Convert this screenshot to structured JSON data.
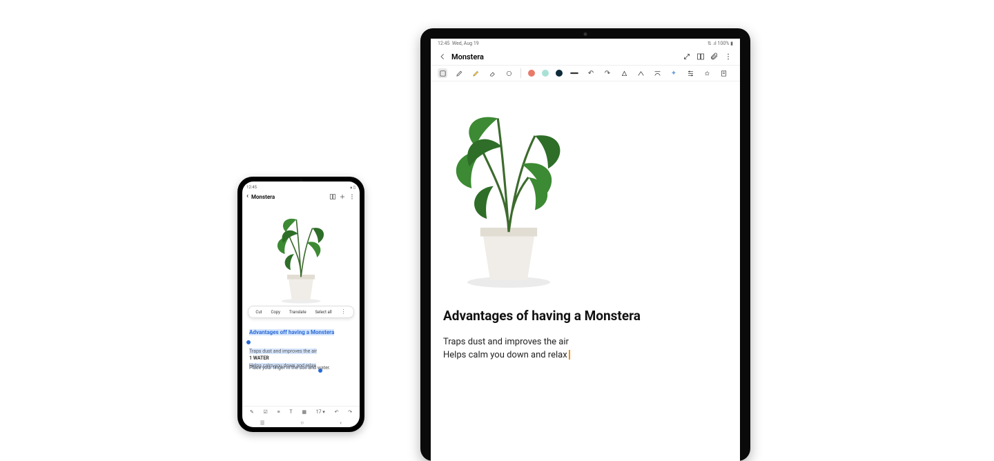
{
  "phone": {
    "status_time": "12:45",
    "title": "Monstera",
    "context_menu": {
      "cut": "Cut",
      "copy": "Copy",
      "translate": "Translate",
      "select_all": "Select all"
    },
    "heading": "Advantages off having a Monstera",
    "line1": "Traps dust and improves the air",
    "line2": "Helps calm you down and relax",
    "water_label": "1 WATER",
    "water_text": "Place your finger in the soil and water.",
    "font_size": "17",
    "nav": {
      "recents": "|||",
      "home": "○",
      "back": "‹"
    }
  },
  "tablet": {
    "status_time": "12:45",
    "status_date": "Wed, Aug 19",
    "status_battery": "100%",
    "title": "Monstera",
    "heading": "Advantages of having a Monstera",
    "line1": "Traps dust and improves the air",
    "line2": "Helps calm you down and relax",
    "colors": {
      "c1": "#e87a6a",
      "c2": "#a9e2d5",
      "c3": "#0e2a3a"
    }
  }
}
